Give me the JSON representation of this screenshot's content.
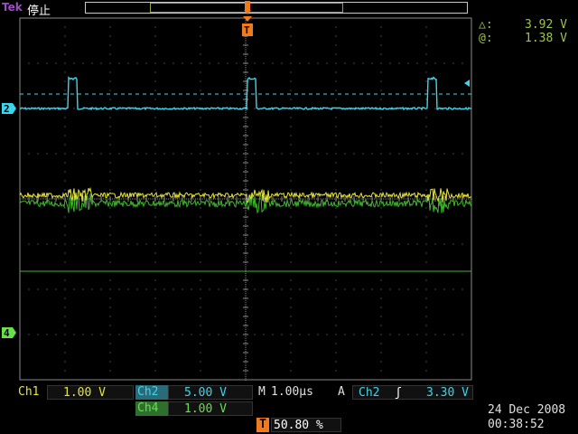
{
  "header": {
    "brand": "Tek",
    "run_state": "停止"
  },
  "readout": {
    "delta_symbol": "△:",
    "delta_value": "3.92 V",
    "at_symbol": "@:",
    "at_value": "1.38 V"
  },
  "channels": {
    "ch1": {
      "label": "Ch1",
      "scale": "1.00 V",
      "marker": "1",
      "color": "#e6e63a"
    },
    "ch2": {
      "label": "Ch2",
      "scale": "5.00 V",
      "marker": "2",
      "color": "#3cd6ec"
    },
    "ch4": {
      "label": "Ch4",
      "scale": "1.00 V",
      "marker": "4",
      "color": "#68e04a"
    }
  },
  "timebase": {
    "label": "M",
    "value": "1.00µs"
  },
  "trigger": {
    "mode": "A",
    "source": "Ch2",
    "slope": "ʃ",
    "level": "3.30 V",
    "marker": "T",
    "position_value": "50.80 %"
  },
  "timestamp": {
    "date": "24 Dec  2008",
    "time": "00:38:52"
  },
  "colors": {
    "graticule": "#777777",
    "ch1": "#e6e63a",
    "ch2": "#3cd6ec",
    "ch4": "#3fb52e",
    "trigger": "#f07a1c"
  }
}
